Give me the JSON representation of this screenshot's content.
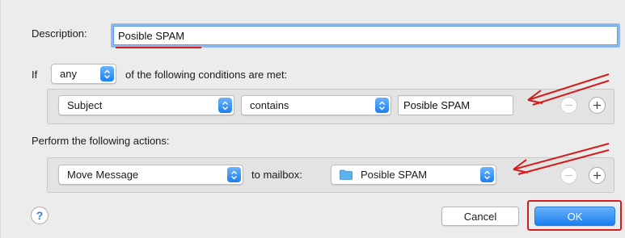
{
  "description": {
    "label": "Description:",
    "value": "Posible SPAM"
  },
  "if_row": {
    "prefix": "If",
    "selected": "any",
    "suffix": "of the following conditions are met:"
  },
  "condition": {
    "field": "Subject",
    "operator": "contains",
    "value": "Posible SPAM"
  },
  "actions": {
    "heading": "Perform the following actions:",
    "action": "Move Message",
    "mailbox_label": "to mailbox:",
    "mailbox": "Posible SPAM"
  },
  "buttons": {
    "help": "?",
    "cancel": "Cancel",
    "ok": "OK",
    "minus_icon": "minus-icon",
    "plus_icon": "plus-icon"
  },
  "colors": {
    "accent": "#1a7ff0",
    "annotation": "#d21d1d",
    "background": "#ececec"
  }
}
